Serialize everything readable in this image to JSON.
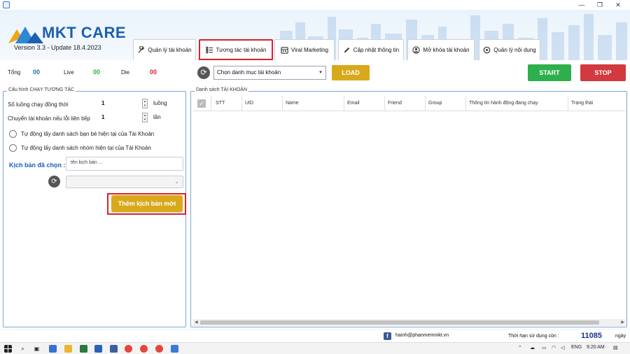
{
  "window": {
    "minimize": "—",
    "maximize": "❐",
    "close": "✕"
  },
  "header": {
    "brand": "MKT CARE",
    "version": "Version 3.3 - Update 18.4.2023",
    "tabs": [
      {
        "label": "Quản lý tài khoản",
        "icon": "wrench-icon"
      },
      {
        "label": "Tương tác tài khoản",
        "icon": "list-icon"
      },
      {
        "label": "Viral Marketing",
        "icon": "calendar-icon"
      },
      {
        "label": "Cập nhật thông tin",
        "icon": "pencil-icon"
      },
      {
        "label": "Mở khóa tài khoản",
        "icon": "user-circle-icon"
      },
      {
        "label": "Quản lý nội dung",
        "icon": "content-icon"
      }
    ]
  },
  "stats": {
    "total_label": "Tổng",
    "total_value": "00",
    "live_label": "Live",
    "live_value": "00",
    "die_label": "Die",
    "die_value": "00",
    "category_select": "Chọn danh mục tài khoản",
    "load_label": "LOAD",
    "start_label": "START",
    "stop_label": "STOP",
    "colors": {
      "total": "#1b6fc2",
      "live": "#2cae4a",
      "die": "#d8232a",
      "load": "#d9a91c",
      "start": "#2db04b",
      "stop": "#d23a3f"
    }
  },
  "config": {
    "title": "Cấu hình CHẠY TƯƠNG TÁC",
    "threads_label": "Số luồng chạy đồng thời",
    "threads_value": "1",
    "threads_unit": "luồng",
    "switch_label": "Chuyển tài khoản nếu lỗi liên tiếp",
    "switch_value": "1",
    "switch_unit": "lần",
    "auto_friends": "Tự động lấy danh sách bạn bè hiện tại của Tài Khoản",
    "auto_groups": "Tự động lấy danh sách nhóm hiện tại của Tài Khoản",
    "script_label": "Kịch bản đã chọn :",
    "script_placeholder": "tên kịch bản ...",
    "add_script_label": "Thêm kịch bản mới"
  },
  "accounts": {
    "title": "Danh sách TÀI KHOẢN",
    "columns": [
      "STT",
      "UID",
      "Name",
      "Email",
      "Friend",
      "Group",
      "Thông tin hành động đang chạy",
      "Trạng thái"
    ]
  },
  "footer": {
    "email": "hainh@phanmemmkt.vn",
    "expiry_label": "Thời hạn sử dụng còn :",
    "expiry_value": "11085",
    "expiry_unit": "ngày"
  },
  "taskbar": {
    "language": "ENG",
    "time": "9:20 AM"
  }
}
